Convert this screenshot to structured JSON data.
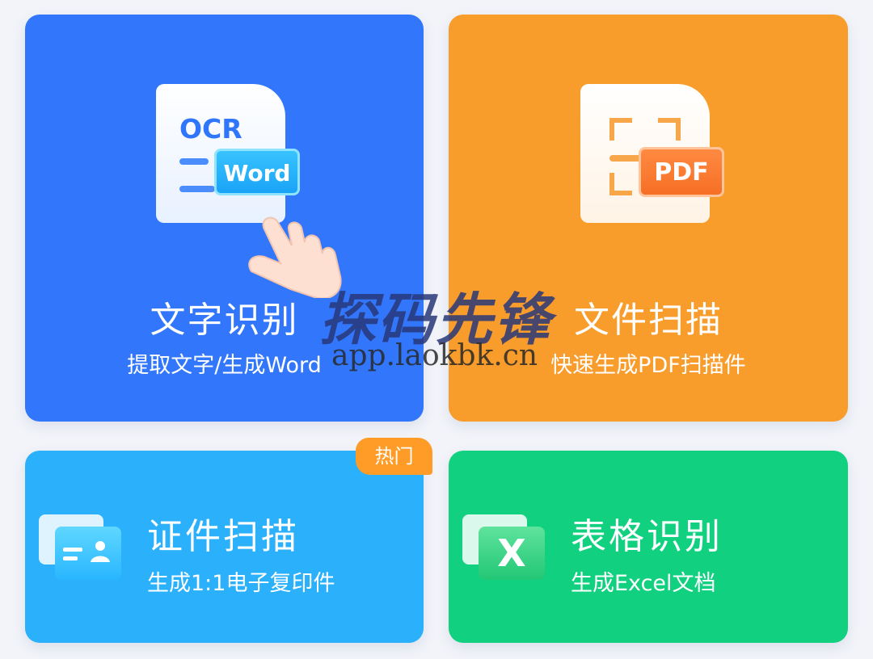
{
  "cards": {
    "ocr": {
      "title": "文字识别",
      "subtitle": "提取文字/生成Word",
      "icon_text": "OCR",
      "tag": "Word",
      "color": "#3277fb"
    },
    "pdf": {
      "title": "文件扫描",
      "subtitle": "快速生成PDF扫描件",
      "tag": "PDF",
      "color": "#f89c2c"
    },
    "id": {
      "title": "证件扫描",
      "subtitle": "生成1:1电子复印件",
      "badge": "热门",
      "color": "#2bb0fb"
    },
    "xls": {
      "title": "表格识别",
      "subtitle": "生成Excel文档",
      "tag": "X",
      "color": "#11d07f"
    }
  },
  "watermark": {
    "name": "探码先锋",
    "url": "app.laokbk.cn"
  }
}
